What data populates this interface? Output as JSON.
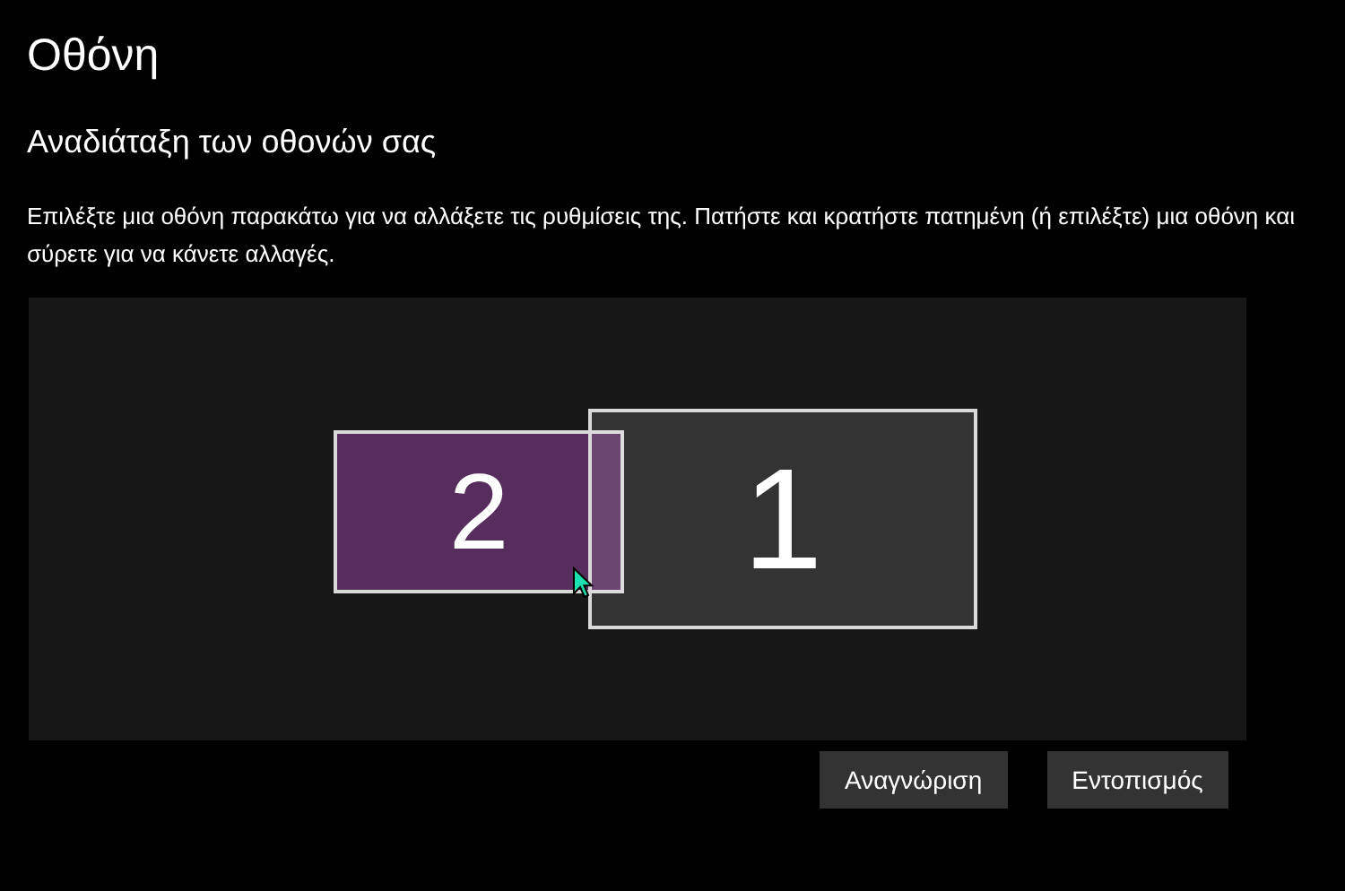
{
  "page_title": "Οθόνη",
  "section_title": "Αναδιάταξη των οθονών σας",
  "description": "Επιλέξτε μια οθόνη παρακάτω για να αλλάξετε τις ρυθμίσεις της. Πατήστε και κρατήστε πατημένη (ή επιλέξτε) μια οθόνη και σύρετε για να κάνετε αλλαγές.",
  "monitors": [
    {
      "label": "2",
      "selected": true
    },
    {
      "label": "1",
      "selected": false
    }
  ],
  "buttons": [
    "Αναγνώριση",
    "Εντοπισμός"
  ]
}
